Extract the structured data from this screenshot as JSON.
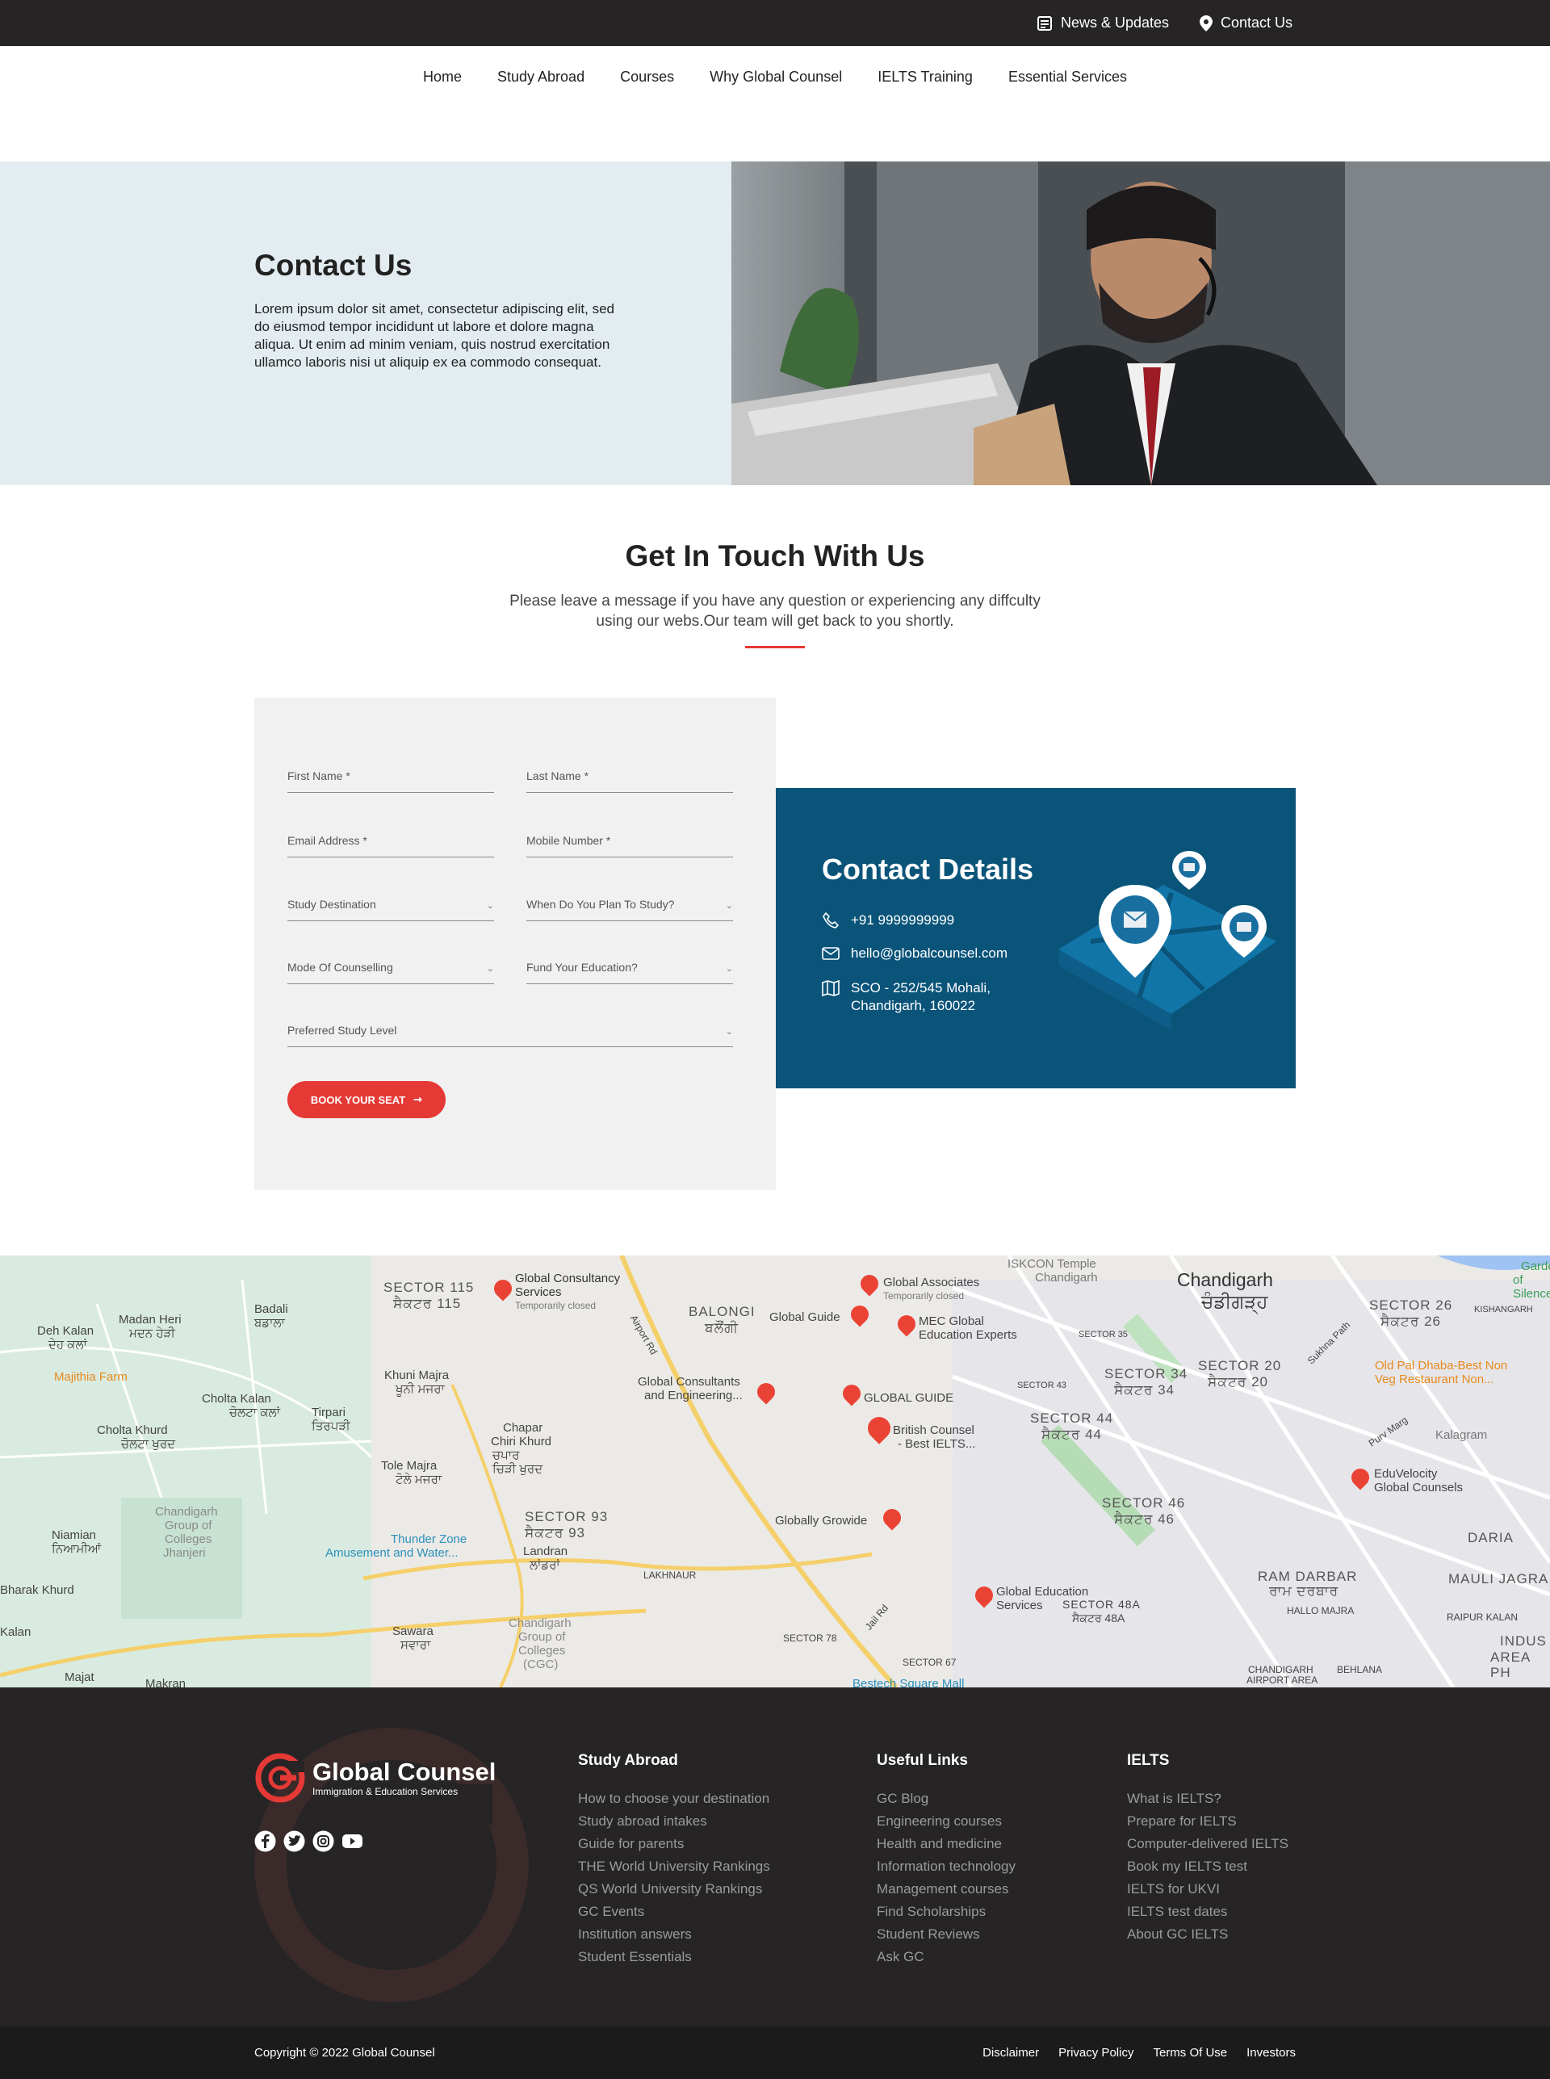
{
  "topbar": {
    "news": "News & Updates",
    "contact": "Contact Us"
  },
  "nav": [
    "Home",
    "Study Abroad",
    "Courses",
    "Why Global Counsel",
    "IELTS Training",
    "Essential Services"
  ],
  "hero": {
    "title": "Contact Us",
    "text": "Lorem ipsum dolor sit amet, consectetur adipiscing elit, sed do eiusmod tempor incididunt ut labore et dolore magna aliqua. Ut enim ad minim veniam, quis nostrud exercitation ullamco laboris nisi ut aliquip ex ea commodo consequat."
  },
  "section": {
    "title": "Get In Touch With Us",
    "subtitle": "Please leave a message if you have any question or experiencing any diffculty using our webs.Our team will get back to you shortly."
  },
  "form": {
    "first_name": "First Name *",
    "last_name": "Last Name *",
    "email": "Email Address *",
    "mobile": "Mobile Number *",
    "study_destination": "Study Destination",
    "when_plan": "When Do You Plan To Study?",
    "mode": "Mode Of Counselling",
    "fund": "Fund Your Education?",
    "level": "Preferred Study Level",
    "button": "BOOK YOUR SEAT"
  },
  "contact_details": {
    "title": "Contact Details",
    "phone": "+91 9999999999",
    "email": "hello@globalcounsel.com",
    "address_line1": "SCO - 252/545 Mohali,",
    "address_line2": "Chandigarh, 160022"
  },
  "map": {
    "labels": [
      "SECTOR 115",
      "ਸੈਕਟਰ 115",
      "Global Consultancy",
      "Services",
      "Temporarily closed",
      "BALONGI",
      "ਬਲੌਂਗੀ",
      "Global Associates",
      "Temporarily closed",
      "Global Guide",
      "MEC Global",
      "Education Experts",
      "Chandigarh",
      "ਚੰਡੀਗੜ੍ਹ",
      "SECTOR 26",
      "ਸੈਕਟਰ 26",
      "Deh Kalan",
      "ਦੇਹ ਕਲਾਂ",
      "Madan Heri",
      "ਮਦਨ ਹੇੜੀ",
      "Badali",
      "ਬਡਾਲਾ",
      "Majithia Farm",
      "Khuni Majra",
      "ਖੂਨੀ ਮਜਰਾ",
      "Global Consultants",
      "and Engineering...",
      "GLOBAL GUIDE",
      "SECTOR 34",
      "ਸੈਕਟਰ 34",
      "SECTOR 20",
      "ਸੈਕਟਰ 20",
      "Old Pal Dhaba-Best Non",
      "Veg Restaurant Non...",
      "Cholta Kalan",
      "ਚੋਲਟਾ ਕਲਾਂ",
      "Tirpari",
      "ਤਿਰਪੜੀ",
      "Cholta Khurd",
      "ਚੋਲਟਾ ਖੁਰਦ",
      "Chapar",
      "Chiri Khurd",
      "ਚਪਾਰ",
      "ਚਿੜੀ ਖੁਰਦ",
      "British Counsel",
      "- Best IELTS...",
      "SECTOR 44",
      "ਸੈਕਟਰ 44",
      "Kalagram",
      "Tole Majra",
      "ਟੋਲੇ ਮਜਰਾ",
      "EduVelocity",
      "Global Counsels",
      "Chandigarh",
      "Group of",
      "Colleges",
      "Jhanjeri",
      "SECTOR 93",
      "ਸੈਕਟਰ 93",
      "Globally Growide",
      "SECTOR 46",
      "ਸੈਕਟਰ 46",
      "DARIA",
      "Niamian",
      "ਨਿਆਮੀਆਂ",
      "Thunder Zone",
      "Amusement and Water...",
      "Landran",
      "ਲਾਂਡਰਾਂ",
      "LAKHNAUR",
      "RAM DARBAR",
      "ਰਾਮ ਦਰਬਾਰ",
      "MAULI JAGRA",
      "Bharak Khurd",
      "Global Education",
      "Services",
      "SECTOR 48A",
      "ਸੈਕਟਰ 48A",
      "HALLO MAJRA",
      "RAIPUR KALAN",
      "Kalan",
      "Sawara",
      "ਸਵਾਰਾ",
      "Chandigarh",
      "Group of",
      "Colleges",
      "(CGC)",
      "SECTOR 78",
      "SECTOR 67",
      "Majat",
      "Makran",
      "Bestech Square Mall",
      "CHANDIGARH",
      "AIRPORT AREA",
      "BEHLANA",
      "INDUS",
      "AREA PH",
      "ISKCON Temple",
      "Chandigarh",
      "Airport Rd",
      "Jail Rd",
      "Purv Marg",
      "Sukhna Path",
      "SECTOR 35",
      "SECTOR 43",
      "KISHANGARH",
      "Garden",
      "of Silence"
    ]
  },
  "footer": {
    "logo_name": "Global Counsel",
    "logo_tag": "Immigration & Education Services",
    "col1": {
      "title": "Study Abroad",
      "items": [
        "How to choose your destination",
        "Study abroad intakes",
        "Guide for parents",
        "THE World University Rankings",
        "QS World University Rankings",
        "GC Events",
        "Institution answers",
        "Student Essentials"
      ]
    },
    "col2": {
      "title": "Useful Links",
      "items": [
        "GC Blog",
        "Engineering courses",
        "Health and medicine",
        "Information technology",
        "Management courses",
        "Find Scholarships",
        "Student Reviews",
        "Ask GC"
      ]
    },
    "col3": {
      "title": "IELTS",
      "items": [
        "What is IELTS?",
        "Prepare for IELTS",
        "Computer-delivered IELTS",
        "Book my IELTS test",
        "IELTS for UKVI",
        "IELTS test dates",
        "About GC IELTS"
      ]
    },
    "copyright": "Copyright © 2022 Global Counsel",
    "links": [
      "Disclaimer",
      "Privacy Policy",
      "Terms Of Use",
      "Investors"
    ]
  },
  "colors": {
    "accent": "#e53935",
    "contact_panel": "#0a5479",
    "footer": "#262425"
  }
}
